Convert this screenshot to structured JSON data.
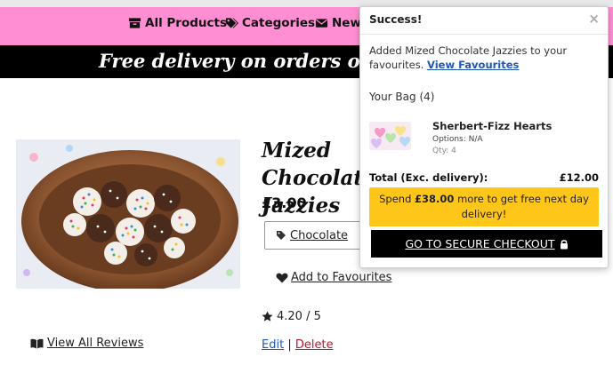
{
  "nav": {
    "items": [
      {
        "label": "All Products",
        "icon": "box-icon"
      },
      {
        "label": "Categories",
        "icon": "tags-icon"
      },
      {
        "label": "News",
        "icon": "envelope-icon"
      }
    ]
  },
  "banner": {
    "text": "Free delivery on orders over "
  },
  "product": {
    "title": "Mized Chocolate Jazzies",
    "price": "£3.00",
    "tag": "Chocolate",
    "add_favourites": "Add to Favourites",
    "rating": "4.20 / 5",
    "view_reviews": "View All Reviews",
    "edit": "Edit",
    "separator": "|",
    "delete": "Delete"
  },
  "popup": {
    "title": "Success!",
    "close": "×",
    "message": "Added Mized Chocolate Jazzies to your favourites.",
    "view_favourites": "View Favourites",
    "bag_label": "Your Bag (4)",
    "bag_items": [
      {
        "name": "Sherbert-Fizz Hearts",
        "options": "Options: N/A",
        "qty": "Qty: 4"
      }
    ],
    "total_label": "Total (Exc. delivery):",
    "total_value": "£12.00",
    "spend_prefix": "Spend ",
    "spend_amount": "£38.00",
    "spend_suffix": " more to get free next day delivery!",
    "checkout": "GO TO SECURE CHECKOUT"
  },
  "colors": {
    "nav_bg": "#ff8fd2",
    "banner_bg": "#000000",
    "spend_bg": "#ffc61a",
    "edit_link": "#1e57b8",
    "delete_link": "#c0142c"
  }
}
